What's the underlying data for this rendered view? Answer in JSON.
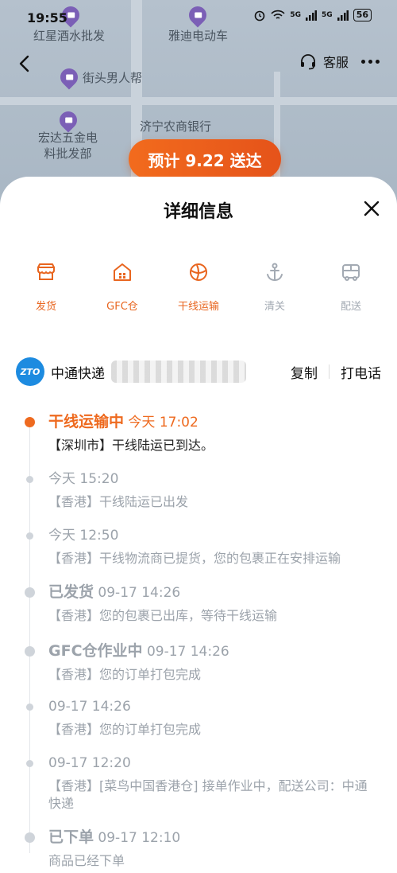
{
  "status_bar": {
    "time": "19:55",
    "signal1": "5G",
    "signal2": "5G",
    "battery": "56"
  },
  "map": {
    "poi_hongxing": "红星酒水批发",
    "poi_yadi": "雅迪电动车",
    "poi_jietou": "街头男人帮",
    "poi_hongda_line1": "宏达五金电",
    "poi_hongda_line2": "料批发部",
    "poi_bank": "济宁农商银行",
    "eta": "预计 9.22 送达"
  },
  "header": {
    "customer_service_label": "客服"
  },
  "sheet": {
    "title": "详细信息",
    "steps": [
      {
        "label": "发货",
        "state": "done",
        "icon": "shop-icon"
      },
      {
        "label": "GFC仓",
        "state": "done",
        "icon": "warehouse-icon"
      },
      {
        "label": "干线运输",
        "state": "done",
        "icon": "trunk-transport-icon"
      },
      {
        "label": "清关",
        "state": "todo",
        "icon": "anchor-icon"
      },
      {
        "label": "配送",
        "state": "todo",
        "icon": "delivery-truck-icon"
      }
    ],
    "carrier": {
      "logo_text": "ZTO",
      "name": "中通快递",
      "copy_label": "复制",
      "call_label": "打电话"
    },
    "events": [
      {
        "title": "干线运输中",
        "time": "今天 17:02",
        "desc": "【深圳市】干线陆运已到达。"
      },
      {
        "title": "",
        "time": "今天 15:20",
        "desc": "【香港】干线陆运已出发"
      },
      {
        "title": "",
        "time": "今天 12:50",
        "desc": "【香港】干线物流商已提货，您的包裹正在安排运输"
      },
      {
        "title": "已发货",
        "time": "09-17 14:26",
        "desc": "【香港】您的包裹已出库，等待干线运输"
      },
      {
        "title": "GFC仓作业中",
        "time": "09-17 14:26",
        "desc": "【香港】您的订单打包完成"
      },
      {
        "title": "",
        "time": "09-17 14:26",
        "desc": "【香港】您的订单打包完成"
      },
      {
        "title": "",
        "time": "09-17 12:20",
        "desc": "【香港】[菜鸟中国香港仓] 接单作业中，配送公司：中通快递"
      },
      {
        "title": "已下单",
        "time": "09-17 12:10",
        "desc": "商品已经下单"
      }
    ]
  },
  "colors": {
    "accent": "#ee6a1f",
    "muted": "#9ca3ab",
    "carrier_blue": "#1d8be0"
  }
}
